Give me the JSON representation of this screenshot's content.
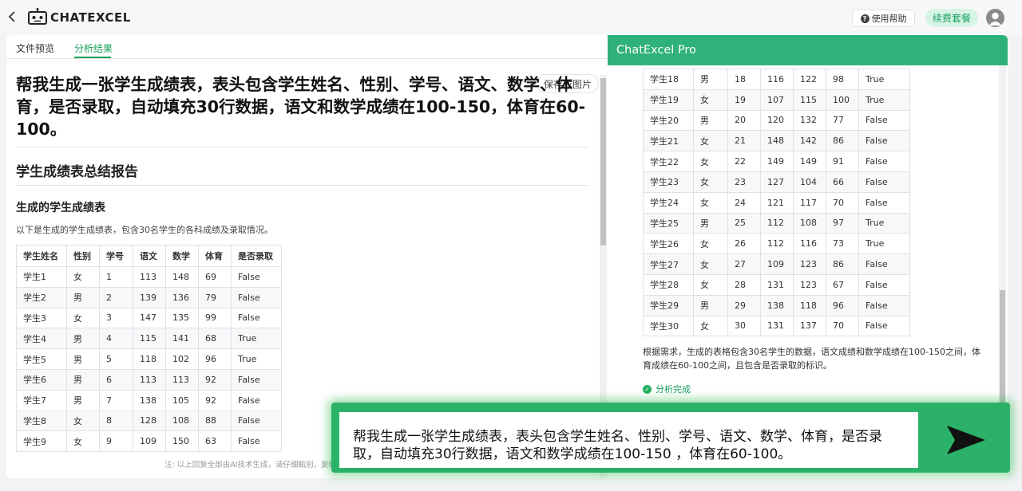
{
  "header": {
    "brand": "CHATEXCEL",
    "help_label": "使用帮助",
    "renew_label": "续费套餐"
  },
  "left": {
    "tabs": [
      {
        "label": "文件预览"
      },
      {
        "label": "分析结果"
      }
    ],
    "save_image_label": "保存成图片",
    "question": "帮我生成一张学生成绩表，表头包含学生姓名、性别、学号、语文、数学、体育，是否录取，自动填充30行数据，语文和数学成绩在100-150，体育在60-100。",
    "report_title": "学生成绩表总结报告",
    "section_title": "生成的学生成绩表",
    "section_desc": "以下是生成的学生成绩表，包含30名学生的各科成绩及录取情况。",
    "footnote": "注: 以上回复全部由AI技术生成，请仔细甄别，复制"
  },
  "table": {
    "headers": [
      "学生姓名",
      "性别",
      "学号",
      "语文",
      "数学",
      "体育",
      "是否录取"
    ],
    "rows_left": [
      [
        "学生1",
        "女",
        "1",
        "113",
        "148",
        "69",
        "False"
      ],
      [
        "学生2",
        "男",
        "2",
        "139",
        "136",
        "79",
        "False"
      ],
      [
        "学生3",
        "女",
        "3",
        "147",
        "135",
        "99",
        "False"
      ],
      [
        "学生4",
        "男",
        "4",
        "115",
        "141",
        "68",
        "True"
      ],
      [
        "学生5",
        "男",
        "5",
        "118",
        "102",
        "96",
        "True"
      ],
      [
        "学生6",
        "男",
        "6",
        "113",
        "113",
        "92",
        "False"
      ],
      [
        "学生7",
        "男",
        "7",
        "138",
        "105",
        "92",
        "False"
      ],
      [
        "学生8",
        "女",
        "8",
        "128",
        "108",
        "88",
        "False"
      ],
      [
        "学生9",
        "女",
        "9",
        "109",
        "150",
        "63",
        "False"
      ]
    ],
    "rows_right": [
      [
        "学生18",
        "男",
        "18",
        "116",
        "122",
        "98",
        "True"
      ],
      [
        "学生19",
        "女",
        "19",
        "107",
        "115",
        "100",
        "True"
      ],
      [
        "学生20",
        "男",
        "20",
        "120",
        "132",
        "77",
        "False"
      ],
      [
        "学生21",
        "女",
        "21",
        "148",
        "142",
        "86",
        "False"
      ],
      [
        "学生22",
        "女",
        "22",
        "149",
        "149",
        "91",
        "False"
      ],
      [
        "学生23",
        "女",
        "23",
        "127",
        "104",
        "66",
        "False"
      ],
      [
        "学生24",
        "女",
        "24",
        "121",
        "117",
        "70",
        "False"
      ],
      [
        "学生25",
        "男",
        "25",
        "112",
        "108",
        "97",
        "True"
      ],
      [
        "学生26",
        "女",
        "26",
        "112",
        "116",
        "73",
        "True"
      ],
      [
        "学生27",
        "女",
        "27",
        "109",
        "123",
        "86",
        "False"
      ],
      [
        "学生28",
        "女",
        "28",
        "131",
        "123",
        "67",
        "False"
      ],
      [
        "学生29",
        "男",
        "29",
        "138",
        "118",
        "96",
        "False"
      ],
      [
        "学生30",
        "女",
        "30",
        "131",
        "137",
        "70",
        "False"
      ]
    ]
  },
  "right": {
    "title": "ChatExcel Pro",
    "summary": "根据需求，生成的表格包含30名学生的数据，语文成绩和数学成绩在100-150之间，体育成绩在60-100之间，且包含是否录取的标识。",
    "status": "分析完成"
  },
  "input": {
    "text": "帮我生成一张学生成绩表，表头包含学生姓名、性别、学号、语文、数学、体育，是否录取，自动填充30行数据，语文和数学成绩在100-150 ，体育在60-100。"
  },
  "colors": {
    "accent_green": "#2fb279",
    "tab_active": "#17a05d"
  }
}
